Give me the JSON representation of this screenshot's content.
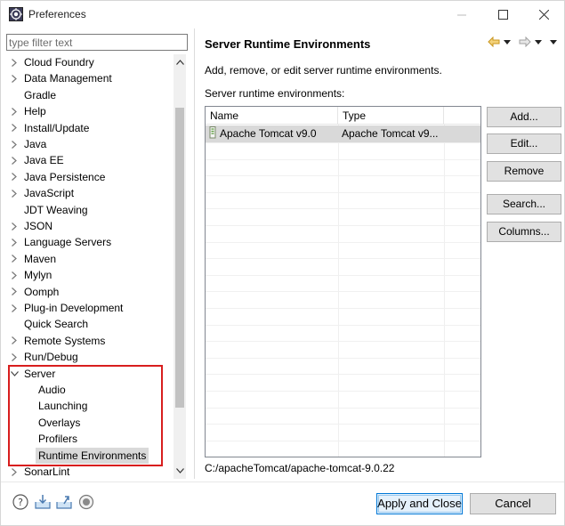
{
  "window": {
    "title": "Preferences",
    "controls": [
      "minimize-icon",
      "maximize-icon",
      "close-icon"
    ]
  },
  "filter": {
    "placeholder": "type filter text"
  },
  "tree": {
    "items": [
      {
        "label": "Cloud Foundry",
        "expandable": true,
        "expanded": false,
        "level": 0
      },
      {
        "label": "Data Management",
        "expandable": true,
        "expanded": false,
        "level": 0
      },
      {
        "label": "Gradle",
        "expandable": false,
        "level": 0
      },
      {
        "label": "Help",
        "expandable": true,
        "expanded": false,
        "level": 0
      },
      {
        "label": "Install/Update",
        "expandable": true,
        "expanded": false,
        "level": 0
      },
      {
        "label": "Java",
        "expandable": true,
        "expanded": false,
        "level": 0
      },
      {
        "label": "Java EE",
        "expandable": true,
        "expanded": false,
        "level": 0
      },
      {
        "label": "Java Persistence",
        "expandable": true,
        "expanded": false,
        "level": 0
      },
      {
        "label": "JavaScript",
        "expandable": true,
        "expanded": false,
        "level": 0
      },
      {
        "label": "JDT Weaving",
        "expandable": false,
        "level": 0
      },
      {
        "label": "JSON",
        "expandable": true,
        "expanded": false,
        "level": 0
      },
      {
        "label": "Language Servers",
        "expandable": true,
        "expanded": false,
        "level": 0
      },
      {
        "label": "Maven",
        "expandable": true,
        "expanded": false,
        "level": 0
      },
      {
        "label": "Mylyn",
        "expandable": true,
        "expanded": false,
        "level": 0
      },
      {
        "label": "Oomph",
        "expandable": true,
        "expanded": false,
        "level": 0
      },
      {
        "label": "Plug-in Development",
        "expandable": true,
        "expanded": false,
        "level": 0
      },
      {
        "label": "Quick Search",
        "expandable": false,
        "level": 0
      },
      {
        "label": "Remote Systems",
        "expandable": true,
        "expanded": false,
        "level": 0
      },
      {
        "label": "Run/Debug",
        "expandable": true,
        "expanded": false,
        "level": 0
      },
      {
        "label": "Server",
        "expandable": true,
        "expanded": true,
        "level": 0
      },
      {
        "label": "Audio",
        "expandable": false,
        "level": 1
      },
      {
        "label": "Launching",
        "expandable": false,
        "level": 1
      },
      {
        "label": "Overlays",
        "expandable": false,
        "level": 1
      },
      {
        "label": "Profilers",
        "expandable": false,
        "level": 1
      },
      {
        "label": "Runtime Environments",
        "expandable": false,
        "level": 1,
        "selected": true
      },
      {
        "label": "SonarLint",
        "expandable": true,
        "expanded": false,
        "level": 0
      }
    ]
  },
  "page": {
    "title": "Server Runtime Environments",
    "description": "Add, remove, or edit server runtime environments.",
    "list_label": "Server runtime environments:",
    "columns": [
      "Name",
      "Type"
    ],
    "rows": [
      {
        "name": "Apache Tomcat v9.0",
        "type": "Apache Tomcat v9..."
      }
    ],
    "path": "C:/apacheTomcat/apache-tomcat-9.0.22"
  },
  "buttons": {
    "add": "Add...",
    "edit": "Edit...",
    "remove": "Remove",
    "search": "Search...",
    "columns": "Columns..."
  },
  "footer": {
    "icons": [
      "help-icon",
      "import-icon",
      "export-icon",
      "oomph-record-icon"
    ],
    "apply": "Apply and Close",
    "cancel": "Cancel"
  },
  "colors": {
    "selection": "#d9d9d9",
    "highlight_box": "#d81e1e",
    "default_button_border": "#0078d7"
  }
}
